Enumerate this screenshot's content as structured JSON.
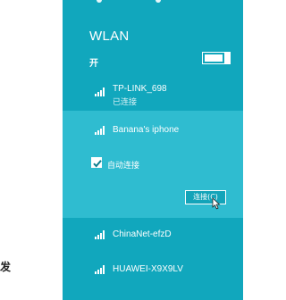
{
  "left_fragment": "发",
  "panel": {
    "title": "WLAN",
    "toggle_label": "开",
    "toggle_on": true
  },
  "networks": [
    {
      "name": "TP-LINK_698",
      "status": "已连接"
    },
    {
      "name": "Banana's iphone",
      "status": ""
    },
    {
      "name": "ChinaNet-efzD",
      "status": ""
    },
    {
      "name": "HUAWEI-X9X9LV",
      "status": ""
    }
  ],
  "expanded": {
    "auto_connect_label": "自动连接",
    "auto_connect_checked": true,
    "connect_button": "连接(C)"
  },
  "colors": {
    "panel_bg": "#11a7bd",
    "selected_bg": "#2fbcd0",
    "text": "#ffffff"
  },
  "icons": [
    "wifi-signal-icon",
    "checkmark-icon",
    "mouse-cursor-icon"
  ]
}
